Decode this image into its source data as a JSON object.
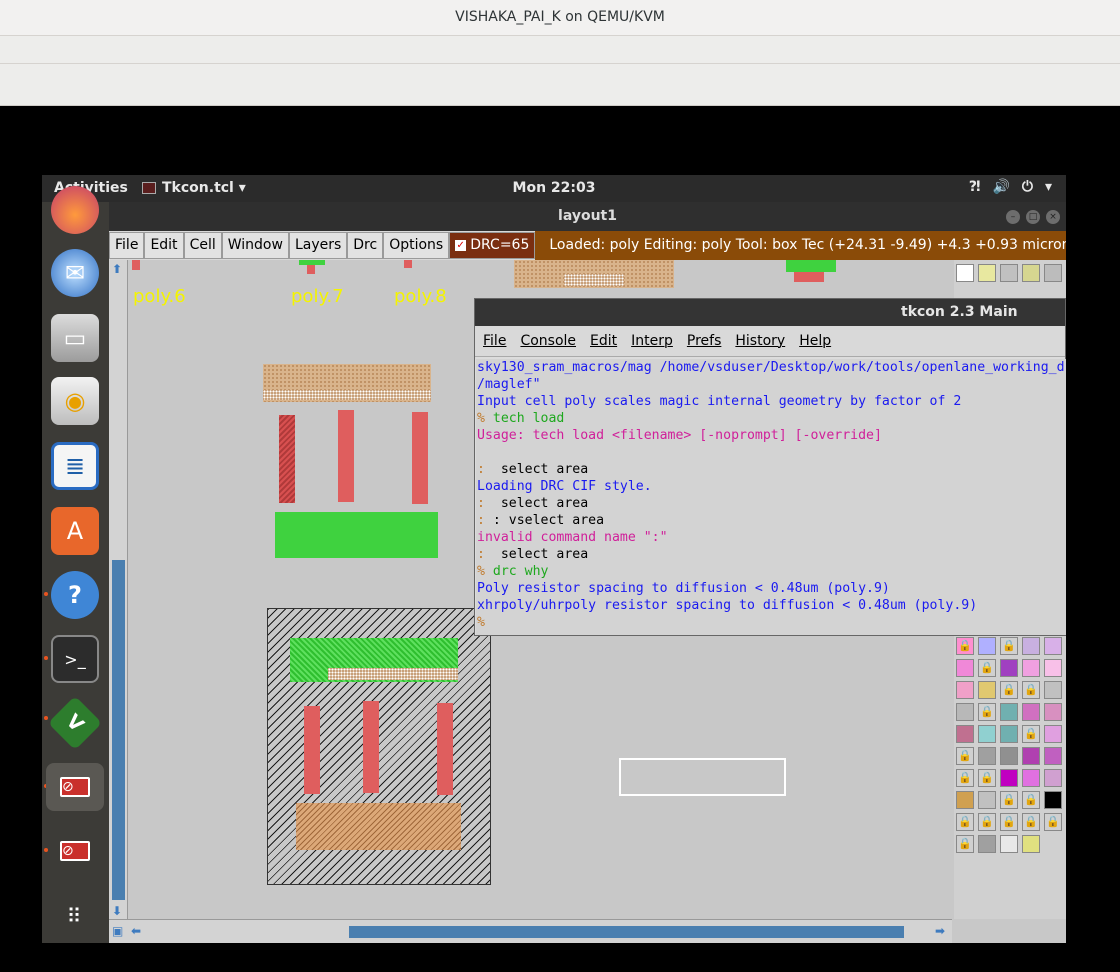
{
  "host": {
    "title": "VISHAKA_PAI_K on QEMU/KVM"
  },
  "topbar": {
    "activities": "Activities",
    "app_menu": "Tkcon.tcl ▾",
    "clock": "Mon 22:03",
    "icons": [
      "accessibility-icon",
      "volume-icon",
      "power-icon",
      "chevron-down-icon"
    ]
  },
  "dock": {
    "items": [
      "firefox-icon",
      "thunderbird-icon",
      "files-icon",
      "rhythmbox-icon",
      "writer-icon",
      "software-icon",
      "help-icon",
      "terminal-icon",
      "vim-icon",
      "no-entry-icon",
      "no-entry-icon",
      "app-grid-icon"
    ]
  },
  "layout_window": {
    "title": "layout1",
    "menu": [
      "File",
      "Edit",
      "Cell",
      "Window",
      "Layers",
      "Drc",
      "Options"
    ],
    "drc_label": "DRC=65",
    "status": "Loaded: poly Editing: poly Tool: box  Tec    (+24.31 -9.49) +4.3 +0.93 microns",
    "labels": [
      "poly.6",
      "poly.7",
      "poly.8"
    ]
  },
  "tkcon": {
    "title": "tkcon 2.3 Main",
    "menu": [
      "File",
      "Console",
      "Edit",
      "Interp",
      "Prefs",
      "History",
      "Help"
    ],
    "lines": [
      {
        "cls": "c-blue",
        "text": "sky130_sram_macros/mag /home/vsduser/Desktop/work/tools/openlane_working_d"
      },
      {
        "cls": "c-blue",
        "text": "/maglef\""
      },
      {
        "cls": "c-blue",
        "text": "Input cell poly scales magic internal geometry by factor of 2"
      },
      {
        "cls": "c-green",
        "prompt": "% ",
        "text": "tech load"
      },
      {
        "cls": "c-magenta",
        "text": "Usage: tech load <filename> [-noprompt] [-override]"
      },
      {
        "cls": "c-black",
        "text": ""
      },
      {
        "cls": "c-black",
        "prompt": ":  ",
        "text": "select area"
      },
      {
        "cls": "c-blue",
        "text": "Loading DRC CIF style."
      },
      {
        "cls": "c-black",
        "prompt": ":  ",
        "text": "select area"
      },
      {
        "cls": "c-black",
        "prompt": ": ",
        "text": ": vselect area"
      },
      {
        "cls": "c-magenta",
        "text": "invalid command name \":\""
      },
      {
        "cls": "c-black",
        "prompt": ":  ",
        "text": "select area"
      },
      {
        "cls": "c-green",
        "prompt": "% ",
        "text": "drc why"
      },
      {
        "cls": "c-blue",
        "text": "Poly resistor spacing to diffusion < 0.48um (poly.9)"
      },
      {
        "cls": "c-blue",
        "text": "xhrpoly/uhrpoly resistor spacing to diffusion < 0.48um (poly.9)"
      },
      {
        "cls": "c-prompt",
        "prompt": "%",
        "text": ""
      }
    ]
  }
}
